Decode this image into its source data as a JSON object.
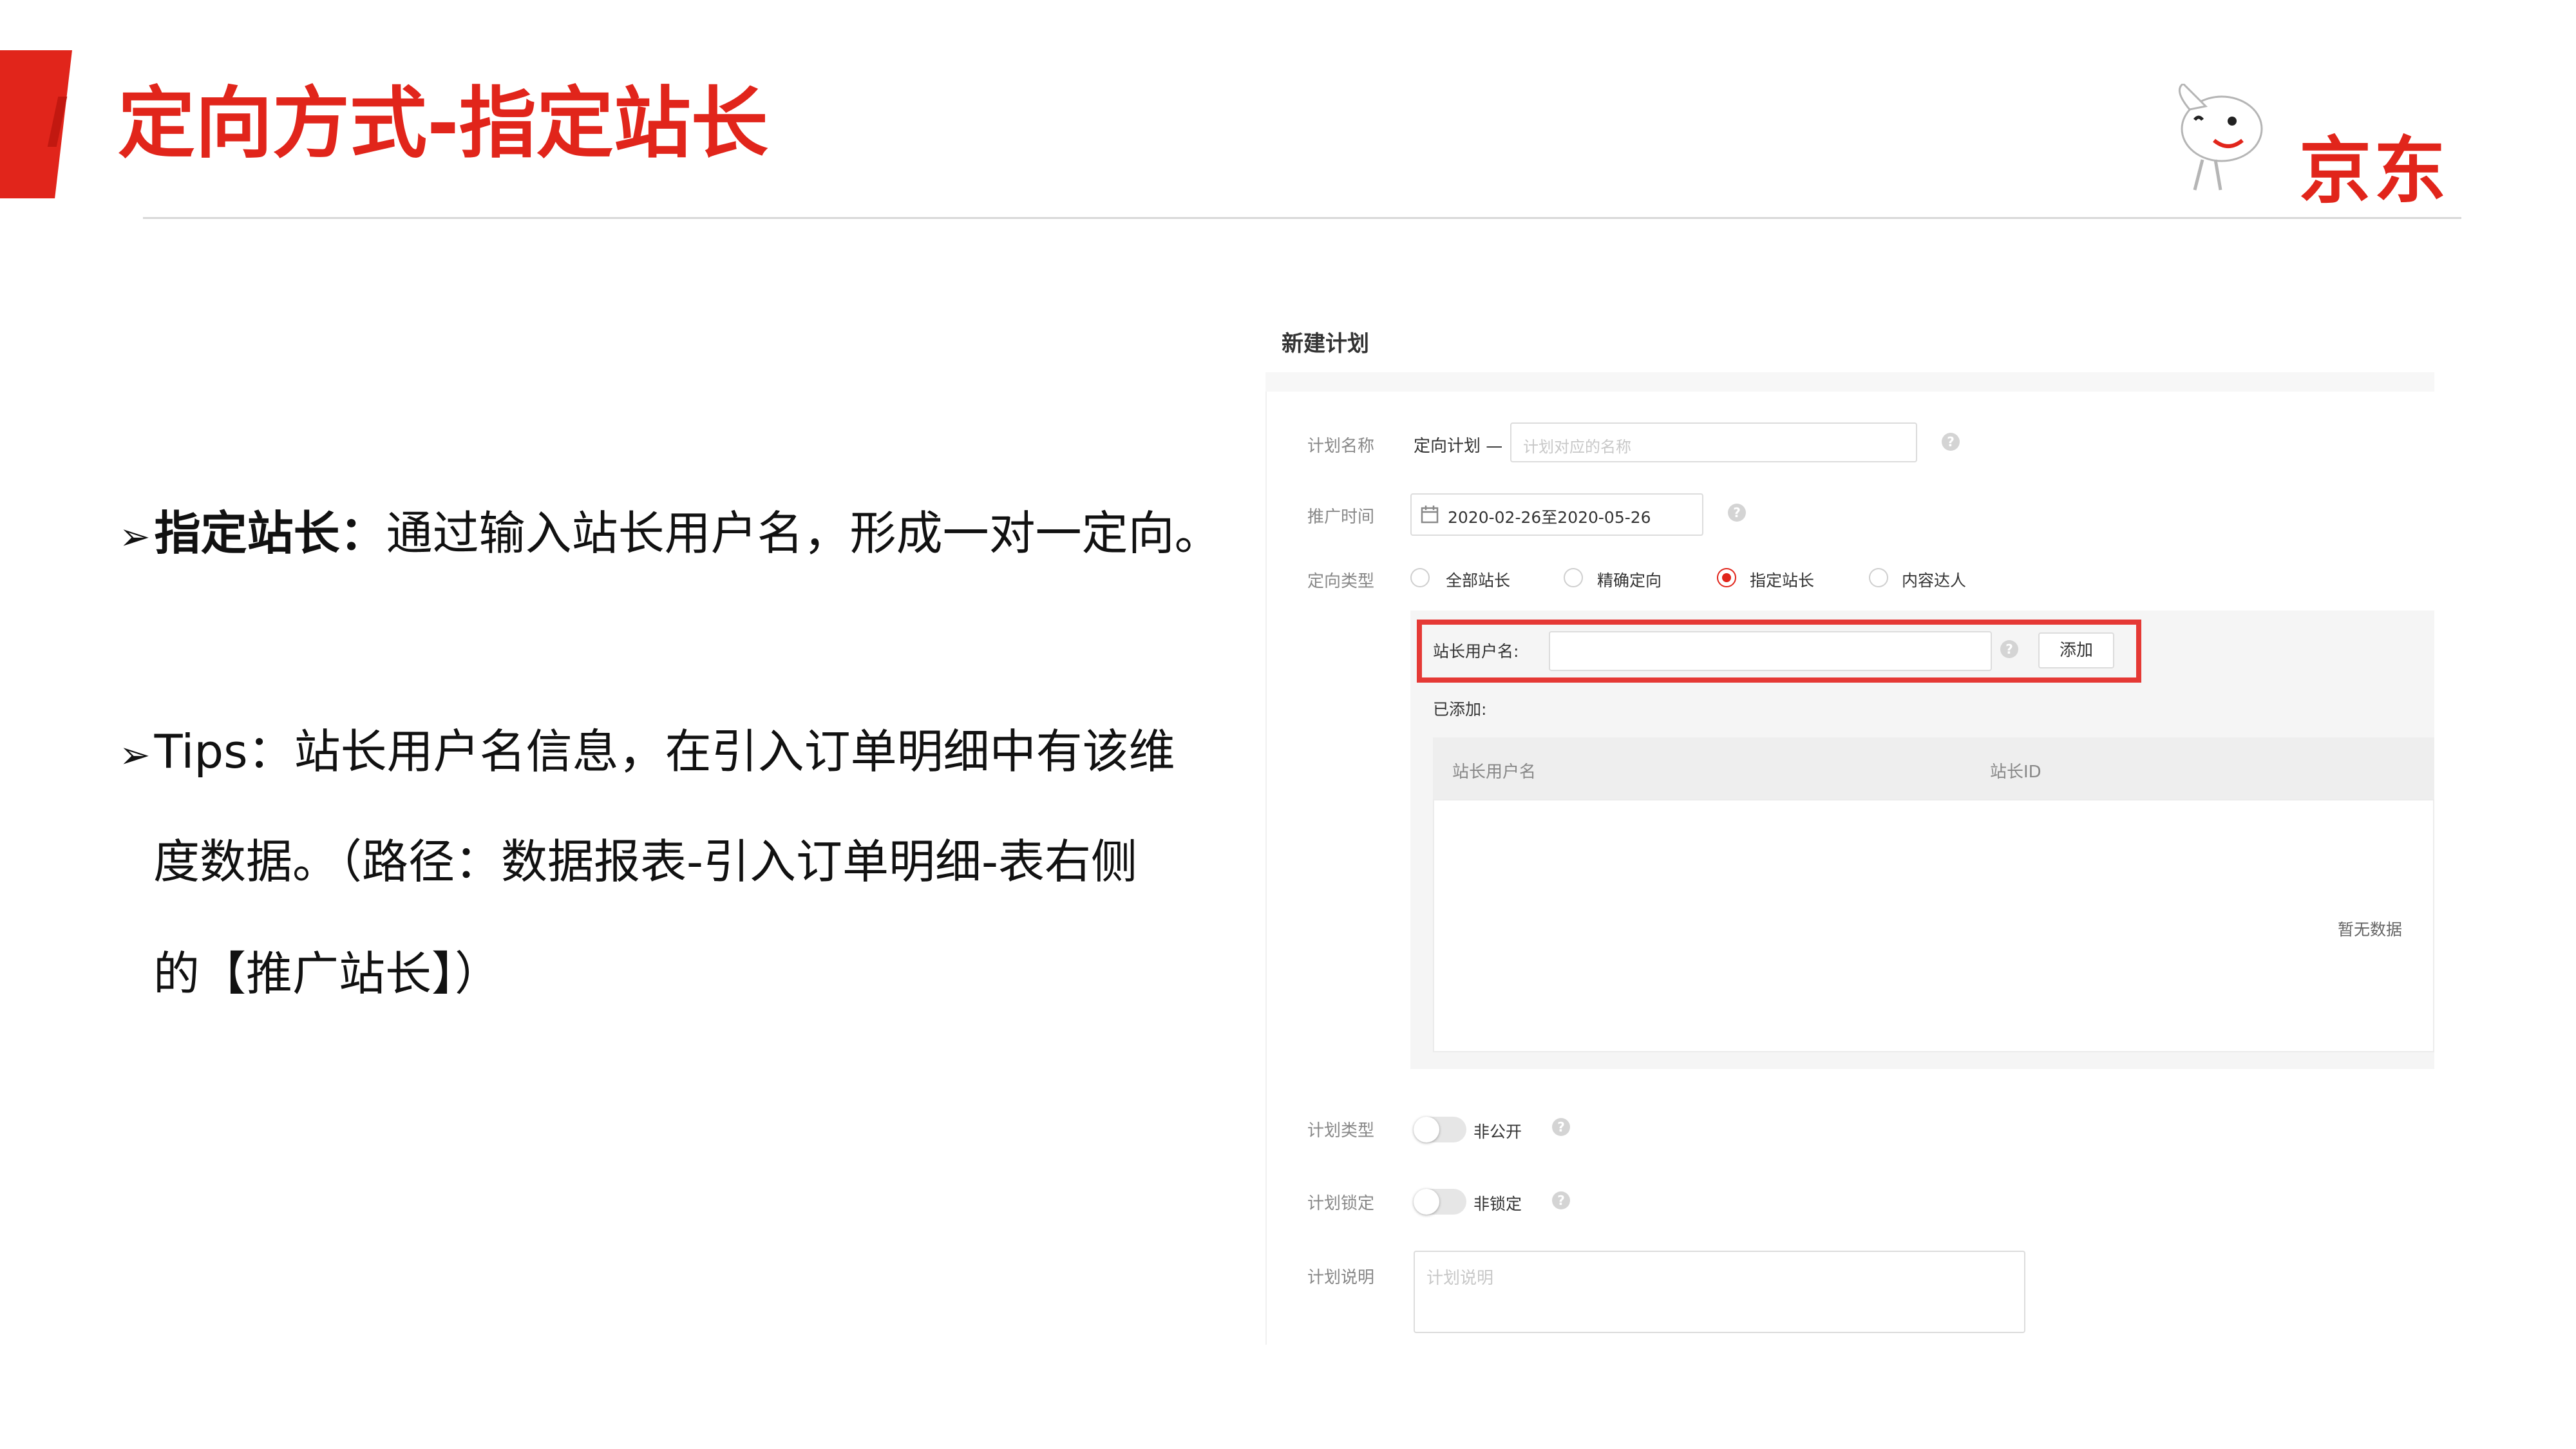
{
  "slide": {
    "title": "定向方式-指定站长",
    "logo_text": "京东"
  },
  "bullets": {
    "arrow": "➢",
    "b1_strong": "指定站长：",
    "b1_text": "通过输入站长用户名，形成一对一定向。",
    "b2_line1": "Tips：站长用户名信息，在引入订单明细中有该维",
    "b2_line2": "度数据。（路径：数据报表-引入订单明细-表右侧",
    "b2_line3": "的【推广站长】）"
  },
  "panel": {
    "title": "新建计划",
    "plan_name": {
      "label": "计划名称",
      "prefix": "定向计划 —",
      "placeholder": "计划对应的名称"
    },
    "promo_time": {
      "label": "推广时间",
      "value": "2020-02-26至2020-05-26"
    },
    "target_type": {
      "label": "定向类型",
      "options": [
        "全部站长",
        "精确定向",
        "指定站长",
        "内容达人"
      ],
      "selected": "指定站长"
    },
    "username": {
      "label": "站长用户名:",
      "add_button": "添加",
      "added_label": "已添加:"
    },
    "table": {
      "columns": [
        "站长用户名",
        "站长ID"
      ],
      "empty_text": "暂无数据"
    },
    "plan_type": {
      "label": "计划类型",
      "value": "非公开"
    },
    "plan_lock": {
      "label": "计划锁定",
      "value": "非锁定"
    },
    "plan_desc": {
      "label": "计划说明",
      "placeholder": "计划说明"
    },
    "help_glyph": "?"
  },
  "colors": {
    "brand_red": "#e1251b",
    "highlight_frame": "#e53935"
  }
}
